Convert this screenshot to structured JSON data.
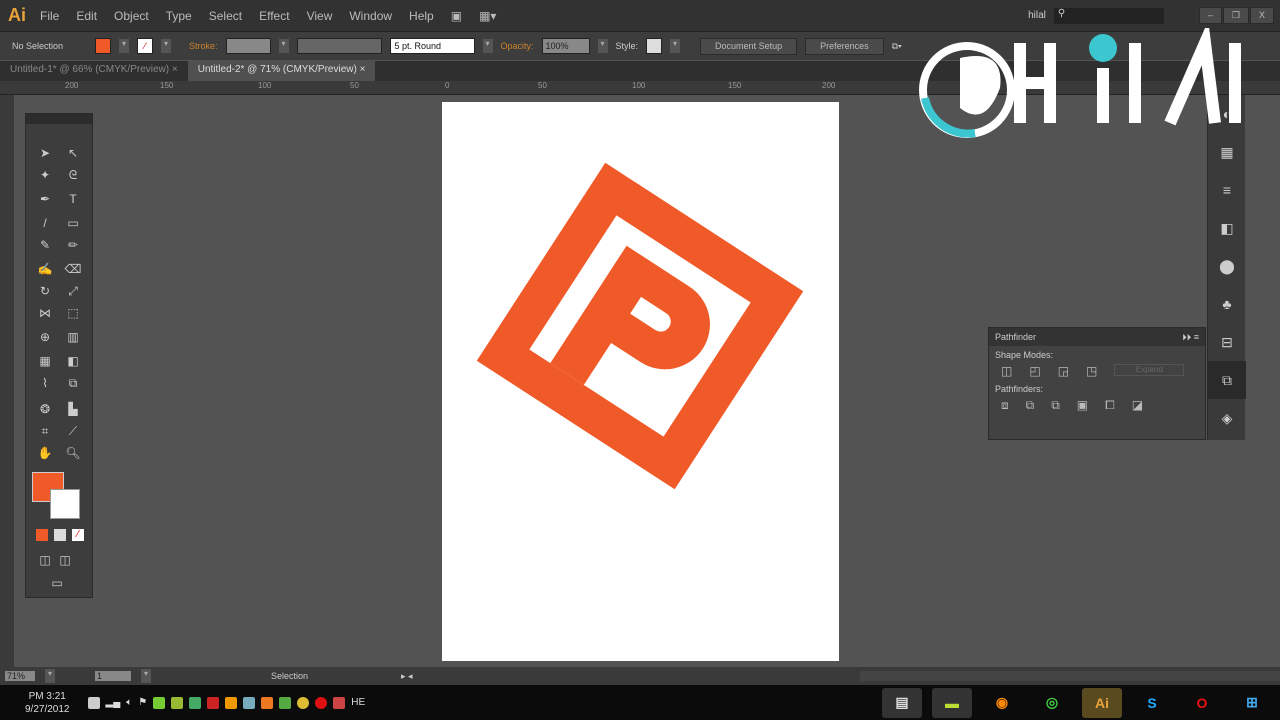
{
  "app": {
    "logo": "Ai",
    "menu": [
      "File",
      "Edit",
      "Object",
      "Type",
      "Select",
      "Effect",
      "View",
      "Window",
      "Help"
    ],
    "user": "hilal",
    "search_placeholder": ""
  },
  "window_controls": {
    "minimize": "–",
    "restore": "❐",
    "close": "X"
  },
  "control_bar": {
    "selection": "No Selection",
    "stroke_label": "Stroke:",
    "brush": "5 pt. Round",
    "opacity_label": "Opacity:",
    "opacity": "100%",
    "style_label": "Style:",
    "document_setup": "Document Setup",
    "preferences": "Preferences"
  },
  "tabs": [
    {
      "label": "Untitled-1* @ 66% (CMYK/Preview)",
      "close": "×"
    },
    {
      "label": "Untitled-2* @ 71% (CMYK/Preview)",
      "close": "×"
    }
  ],
  "ruler": [
    "200",
    "150",
    "100",
    "50",
    "0",
    "50",
    "100",
    "150",
    "200"
  ],
  "pathfinder": {
    "title": "Pathfinder",
    "shape_modes": "Shape Modes:",
    "pathfinders": "Pathfinders:",
    "expand": "Expand"
  },
  "status": {
    "zoom": "71%",
    "artboard": "1",
    "tool": "Selection"
  },
  "taskbar": {
    "time": "PM 3:21",
    "date": "9/27/2012",
    "lang": "HE"
  },
  "colors": {
    "fill": "#f05a28",
    "accent": "#3cc6d0"
  },
  "watermark": "hilal"
}
